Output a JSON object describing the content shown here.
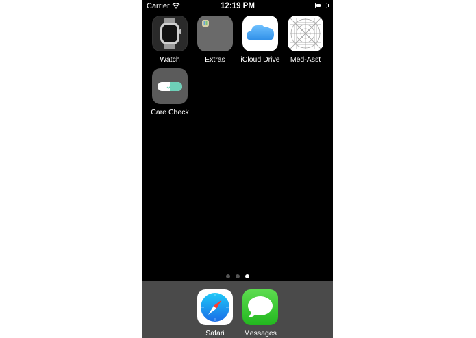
{
  "status": {
    "carrier": "Carrier",
    "time": "12:19 PM"
  },
  "apps": [
    {
      "label": "Watch",
      "icon": "watch-icon"
    },
    {
      "label": "Extras",
      "icon": "folder-icon"
    },
    {
      "label": "iCloud Drive",
      "icon": "cloud-icon"
    },
    {
      "label": "Med-Asst",
      "icon": "grid-icon"
    },
    {
      "label": "Care Check",
      "icon": "pill-icon"
    }
  ],
  "page_dots": {
    "count": 3,
    "active_index": 2
  },
  "dock": [
    {
      "label": "Safari",
      "icon": "compass-icon"
    },
    {
      "label": "Messages",
      "icon": "speech-bubble-icon"
    }
  ],
  "colors": {
    "wallpaper": "#000000",
    "dock": "#4a4a4a",
    "icloud_blue": "#4aa8f0",
    "care_check_green": "#6ed0b8",
    "messages_green": "#34c632"
  }
}
